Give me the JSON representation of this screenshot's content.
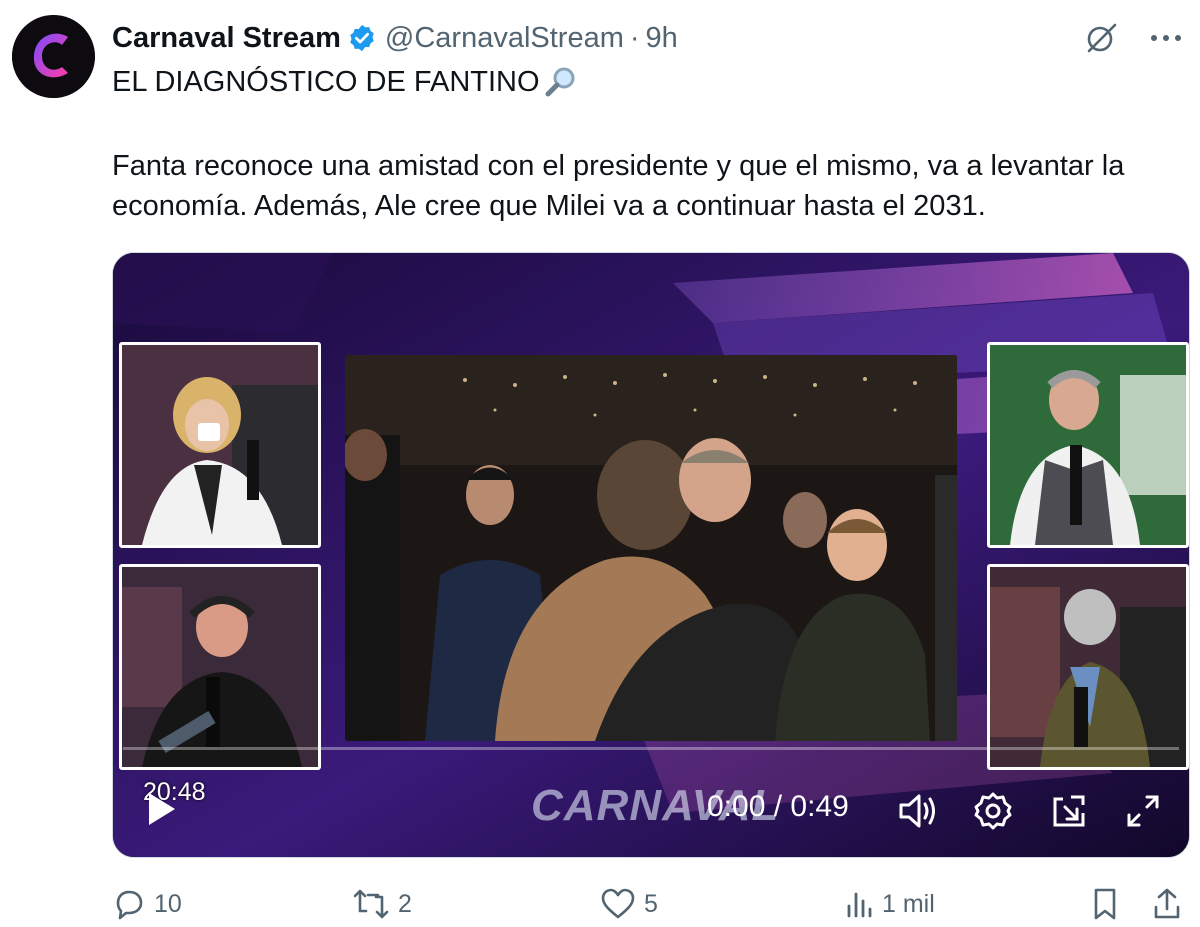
{
  "author": {
    "display_name": "Carnaval Stream",
    "handle": "@CarnavalStream",
    "separator": "·",
    "time": "9h",
    "verified": true,
    "verified_color": "#1d9bf0"
  },
  "header_actions": {
    "grok_icon": "grok-icon",
    "more_icon": "more-icon"
  },
  "tweet": {
    "title": "EL DIAGNÓSTICO DE FANTINO",
    "title_emoji": "magnifying-glass-icon",
    "body": "Fanta reconoce una amistad con el presidente y que el mismo, va a levantar la economía. Además, Ale cree que Milei va a continuar hasta el 2031."
  },
  "video": {
    "duration_badge": "20:48",
    "watermark": "CARNAVAL",
    "timecode": "0:00 / 0:49",
    "progress": 0,
    "accent": "#7b3cff"
  },
  "actions": {
    "replies": "10",
    "reposts": "2",
    "likes": "5",
    "views": "1 mil"
  }
}
